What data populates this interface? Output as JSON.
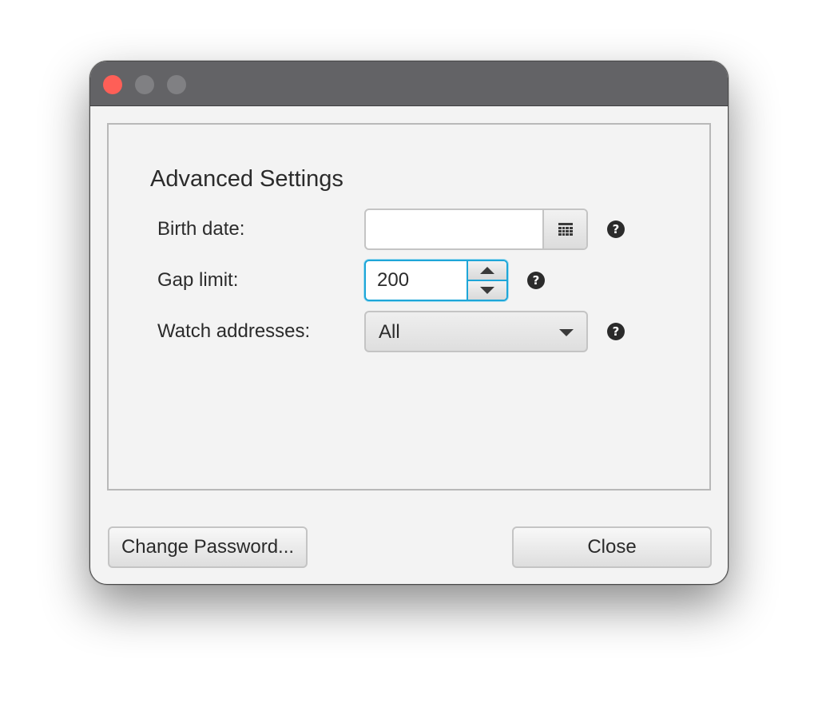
{
  "window": {
    "controls": [
      "close-window",
      "minimize-window",
      "maximize-window"
    ]
  },
  "settings": {
    "section_title": "Advanced Settings",
    "birth_date": {
      "label": "Birth date:",
      "value": "",
      "icon": "calendar-icon",
      "help_icon": "question-icon"
    },
    "gap_limit": {
      "label": "Gap limit:",
      "value": "200",
      "help_icon": "question-icon"
    },
    "watch_addresses": {
      "label": "Watch addresses:",
      "selected": "All",
      "help_icon": "question-icon"
    }
  },
  "buttons": {
    "change_password": "Change Password...",
    "close": "Close"
  },
  "colors": {
    "focus_accent": "#1ea6d8",
    "close_traffic": "#fe5f57",
    "titlebar": "#636366"
  }
}
